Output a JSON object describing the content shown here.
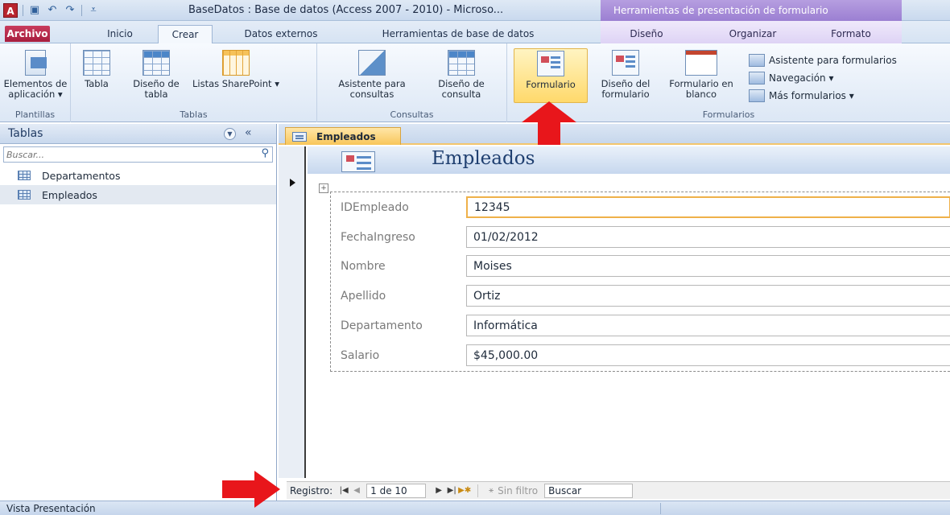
{
  "window": {
    "title": "BaseDatos : Base de datos (Access 2007 - 2010)  -  Microso...",
    "app_logo": "A",
    "context_tools_label": "Herramientas de presentación de formulario"
  },
  "tabs": {
    "archivo": "Archivo",
    "inicio": "Inicio",
    "crear": "Crear",
    "datos_externos": "Datos externos",
    "herramientas_bd": "Herramientas de base de datos",
    "diseno": "Diseño",
    "organizar": "Organizar",
    "formato": "Formato"
  },
  "ribbon": {
    "plantillas": {
      "label": "Plantillas",
      "elementos": "Elementos de aplicación ▾"
    },
    "tablas": {
      "label": "Tablas",
      "tabla": "Tabla",
      "diseno_tabla": "Diseño de tabla",
      "listas": "Listas SharePoint ▾"
    },
    "consultas": {
      "label": "Consultas",
      "asistente": "Asistente para consultas",
      "diseno": "Diseño de consulta"
    },
    "formularios": {
      "label": "Formularios",
      "formulario": "Formulario",
      "diseno_form": "Diseño del formulario",
      "form_blanco": "Formulario en blanco",
      "asistente": "Asistente para formularios",
      "navegacion": "Navegación ▾",
      "mas": "Más formularios ▾"
    }
  },
  "nav_pane": {
    "title": "Tablas",
    "search_placeholder": "Buscar...",
    "items": [
      {
        "label": "Departamentos"
      },
      {
        "label": "Empleados"
      }
    ]
  },
  "document": {
    "tab_label": "Empleados",
    "form_title": "Empleados",
    "fields": [
      {
        "label": "IDEmpleado",
        "value": "12345"
      },
      {
        "label": "FechaIngreso",
        "value": "01/02/2012"
      },
      {
        "label": "Nombre",
        "value": "Moises"
      },
      {
        "label": "Apellido",
        "value": "Ortiz"
      },
      {
        "label": "Departamento",
        "value": "Informática"
      },
      {
        "label": "Salario",
        "value": "$45,000.00"
      }
    ]
  },
  "record_nav": {
    "label": "Registro:",
    "current": "1 de 10",
    "filter": "Sin filtro",
    "search_value": "Buscar"
  },
  "status": {
    "text": "Vista Presentación"
  },
  "colors": {
    "archivo_tab": "#b8254a",
    "context_tools": "#a68ad9",
    "highlight": "#ffd96b",
    "focus_border": "#efb14a",
    "annotation_arrow": "#e8161b"
  }
}
